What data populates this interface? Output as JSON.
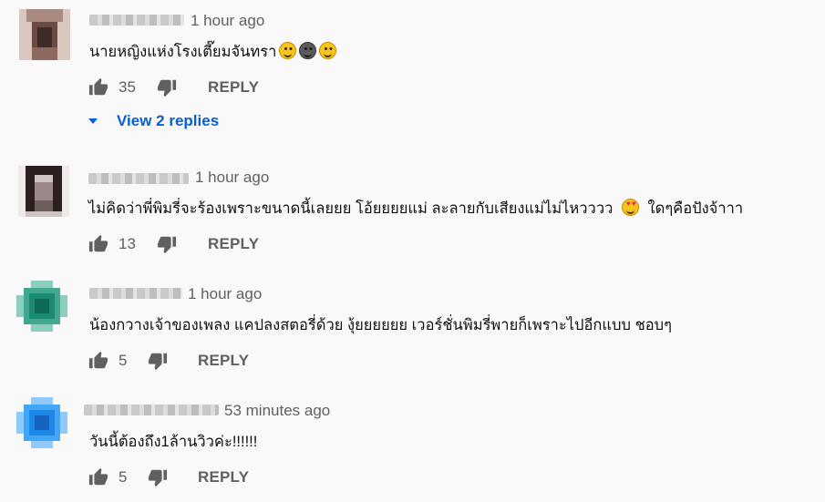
{
  "comments": [
    {
      "time": "1 hour ago",
      "text": "นายหญิงแห่งโรงเตี๊ยมจันทรา",
      "likes": "35",
      "reply_label": "REPLY",
      "view_replies": "View 2 replies",
      "emojis": [
        "slightly-smiling-face",
        "dark-smiling-face",
        "smiling-face"
      ],
      "avatar_colors": [
        "#6b4a44",
        "#3e2b2a",
        "#a88a80",
        "#d9c7c0",
        "#8c6a61"
      ]
    },
    {
      "time": "1 hour ago",
      "text_a": "ไม่คิดว่าพี่พิมรี่จะร้องเพราะขนาดนี้เลยยย โอ้ยยยยแม่ ละลายกับเสียงแม่ไม่ไหวววว",
      "text_b": "ใดๆคือปังจ้าาา",
      "likes": "13",
      "reply_label": "REPLY",
      "emojis": [
        "smiling-face-with-hearts"
      ],
      "avatar_colors": [
        "#2a2020",
        "#6e5d5d",
        "#cfc3c3",
        "#efe9e9",
        "#9b8888"
      ]
    },
    {
      "time": "1 hour ago",
      "text": "น้องกวางเจ้าของเพลง แคปลงสตอรี่ด้วย งุ้ยยยยยย  เวอร์ชั่นพิมรี่พายก็เพราะไปอีกแบบ ชอบๆ",
      "likes": "5",
      "reply_label": "REPLY",
      "avatar_colors": [
        "#1d8a73",
        "#0f6b57",
        "#43a78f",
        "#8ccfbf",
        "#d6efe8"
      ]
    },
    {
      "time": "53 minutes ago",
      "text": "วันนี้ต้องถึง1ล้านวิวค่ะ!!!!!!",
      "likes": "5",
      "reply_label": "REPLY",
      "avatar_colors": [
        "#1e88e5",
        "#1565c0",
        "#42a5f5",
        "#90caf9",
        "#e3f2fd"
      ]
    }
  ],
  "icons": {
    "like": "thumbs-up-icon",
    "dislike": "thumbs-down-icon",
    "expand": "caret-down-icon"
  },
  "colors": {
    "background": "#f9f9f9",
    "link": "#065fd4",
    "secondary_text": "#606060"
  }
}
